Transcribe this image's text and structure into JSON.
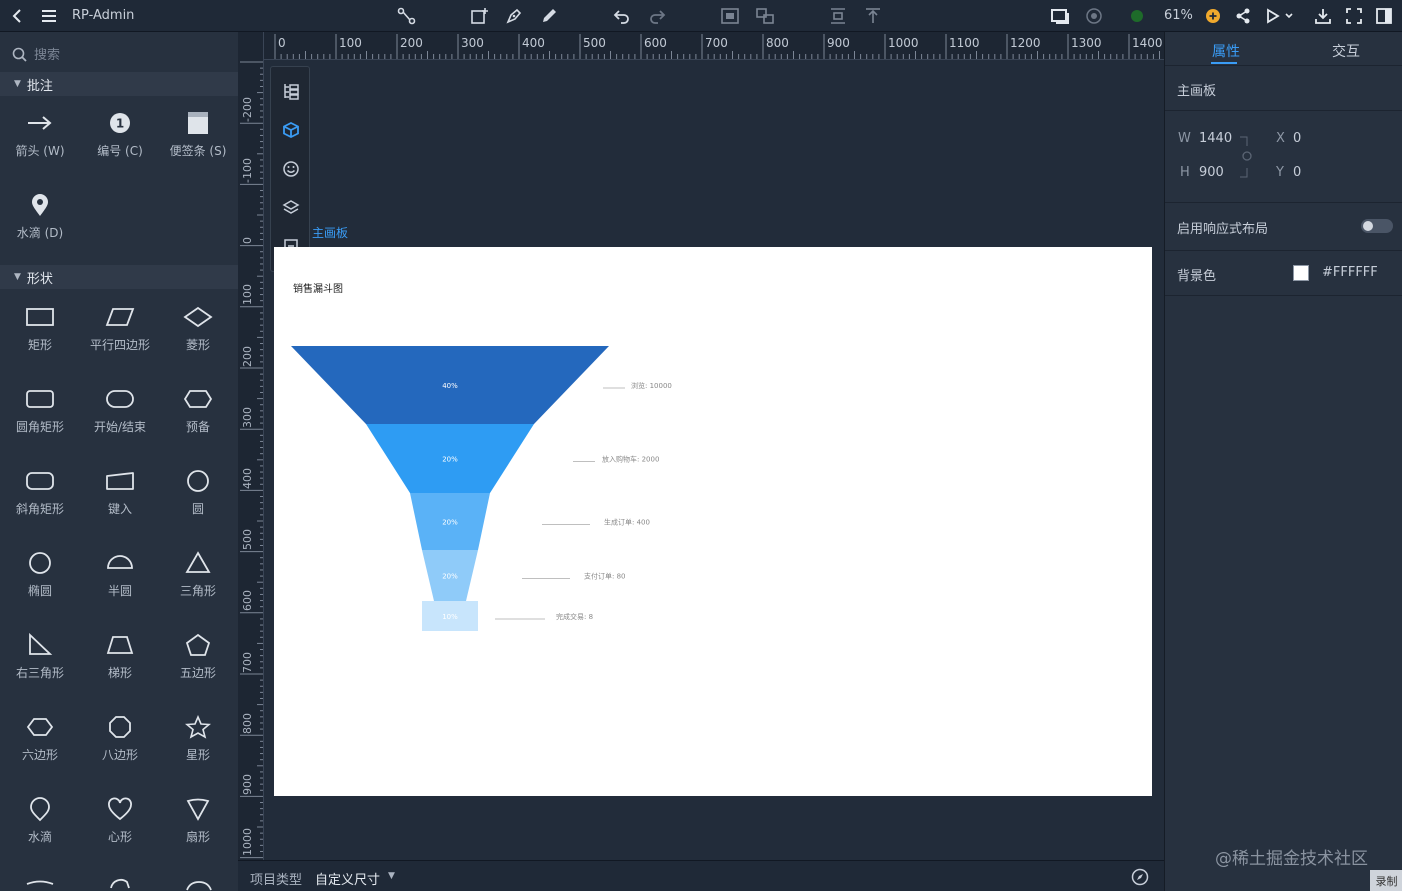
{
  "app": {
    "title": "RP-Admin",
    "zoom": "61%"
  },
  "search": {
    "placeholder": "搜索"
  },
  "sections": {
    "annotations": {
      "title": "批注",
      "items": [
        {
          "label": "箭头 (W)",
          "icon": "arrow-right-icon"
        },
        {
          "label": "编号 (C)",
          "icon": "number-badge-icon"
        },
        {
          "label": "便签条 (S)",
          "icon": "sticky-note-icon"
        },
        {
          "label": "水滴 (D)",
          "icon": "location-pin-icon"
        }
      ]
    },
    "shapes": {
      "title": "形状",
      "items": [
        {
          "label": "矩形",
          "icon": "rectangle-icon"
        },
        {
          "label": "平行四边形",
          "icon": "parallelogram-icon"
        },
        {
          "label": "菱形",
          "icon": "diamond-icon"
        },
        {
          "label": "圆角矩形",
          "icon": "rounded-rectangle-icon"
        },
        {
          "label": "开始/结束",
          "icon": "terminator-icon"
        },
        {
          "label": "预备",
          "icon": "preparation-icon"
        },
        {
          "label": "斜角矩形",
          "icon": "bevel-rectangle-icon"
        },
        {
          "label": "键入",
          "icon": "input-icon"
        },
        {
          "label": "圆",
          "icon": "circle-icon"
        },
        {
          "label": "椭圆",
          "icon": "ellipse-icon"
        },
        {
          "label": "半圆",
          "icon": "semicircle-icon"
        },
        {
          "label": "三角形",
          "icon": "triangle-icon"
        },
        {
          "label": "右三角形",
          "icon": "right-triangle-icon"
        },
        {
          "label": "梯形",
          "icon": "trapezoid-icon"
        },
        {
          "label": "五边形",
          "icon": "pentagon-icon"
        },
        {
          "label": "六边形",
          "icon": "hexagon-icon"
        },
        {
          "label": "八边形",
          "icon": "octagon-icon"
        },
        {
          "label": "星形",
          "icon": "star-icon"
        },
        {
          "label": "水滴",
          "icon": "drop-icon"
        },
        {
          "label": "心形",
          "icon": "heart-icon"
        },
        {
          "label": "扇形",
          "icon": "fan-icon"
        }
      ]
    }
  },
  "rulers": {
    "horizontal": [
      "0",
      "100",
      "200",
      "300",
      "400",
      "500",
      "600",
      "700",
      "800",
      "900",
      "1000",
      "1100",
      "1200",
      "1300",
      "1400"
    ],
    "vertical": [
      "-200",
      "-100",
      "0",
      "100",
      "200",
      "300",
      "400",
      "500",
      "600",
      "700",
      "800",
      "900",
      "1000"
    ]
  },
  "canvas": {
    "board_label": "主画板",
    "chart": {
      "title": "销售漏斗图",
      "chart_data": {
        "type": "funnel",
        "title": "销售漏斗图",
        "stages": [
          {
            "label": "浏览: 10000",
            "percent": "40%",
            "color": "#2468bd"
          },
          {
            "label": "放入购物车: 2000",
            "percent": "20%",
            "color": "#2e9cf3"
          },
          {
            "label": "生成订单: 400",
            "percent": "20%",
            "color": "#5ab2f7"
          },
          {
            "label": "支付订单: 80",
            "percent": "20%",
            "color": "#8fcbf9"
          },
          {
            "label": "完成交易: 8",
            "percent": "10%",
            "color": "#c8e5fc"
          }
        ]
      }
    }
  },
  "right_panel": {
    "tabs": [
      {
        "label": "属性",
        "active": true
      },
      {
        "label": "交互",
        "active": false
      }
    ],
    "board_title": "主画板",
    "w_label": "W",
    "w_value": "1440",
    "h_label": "H",
    "h_value": "900",
    "x_label": "X",
    "x_value": "0",
    "y_label": "Y",
    "y_value": "0",
    "responsive_label": "启用响应式布局",
    "responsive_enabled": false,
    "bg_label": "背景色",
    "bg_value": "#FFFFFF",
    "watermark": "@稀土掘金技术社区",
    "record_badge": "录制"
  },
  "bottom_bar": {
    "label": "项目类型",
    "value": "自定义尺寸"
  }
}
